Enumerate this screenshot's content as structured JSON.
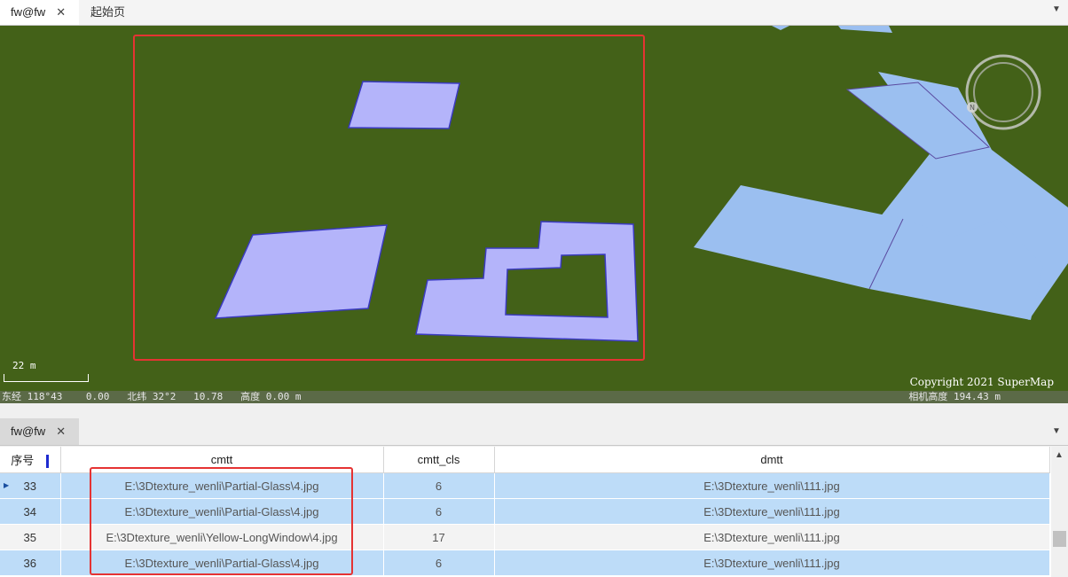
{
  "top_tabs": [
    {
      "label": "fw@fw",
      "close": "✕"
    },
    {
      "label": "起始页"
    }
  ],
  "map": {
    "scale_label": "22 m",
    "copyright": "Copyright 2021 SuperMap",
    "status_left": "东经 118°43    0.00   北纬 32°2   10.78   高度 0.00 m",
    "status_right": "相机高度 194.43 m",
    "colors": {
      "ground": "#436118",
      "selected_polygon": "#b4b4fa",
      "building": "#9bbff0"
    }
  },
  "lower_tab": {
    "label": "fw@fw",
    "close": "✕"
  },
  "grid": {
    "columns": [
      "序号",
      "cmtt",
      "cmtt_cls",
      "dmtt"
    ],
    "rows": [
      {
        "idx": "33",
        "cmtt": "E:\\3Dtexture_wenli\\Partial-Glass\\4.jpg",
        "cmtt_cls": "6",
        "dmtt": "E:\\3Dtexture_wenli\\111.jpg",
        "selected": true
      },
      {
        "idx": "34",
        "cmtt": "E:\\3Dtexture_wenli\\Partial-Glass\\4.jpg",
        "cmtt_cls": "6",
        "dmtt": "E:\\3Dtexture_wenli\\111.jpg",
        "selected": true
      },
      {
        "idx": "35",
        "cmtt": "E:\\3Dtexture_wenli\\Yellow-LongWindow\\4.jpg",
        "cmtt_cls": "17",
        "dmtt": "E:\\3Dtexture_wenli\\111.jpg",
        "selected": false
      },
      {
        "idx": "36",
        "cmtt": "E:\\3Dtexture_wenli\\Partial-Glass\\4.jpg",
        "cmtt_cls": "6",
        "dmtt": "E:\\3Dtexture_wenli\\111.jpg",
        "selected": true
      }
    ]
  }
}
